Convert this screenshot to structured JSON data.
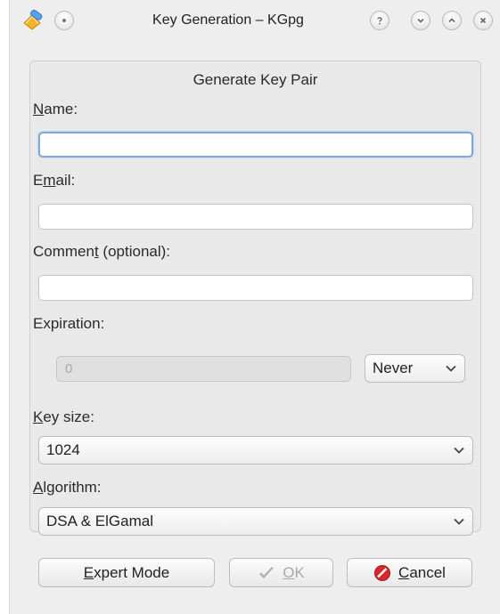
{
  "window": {
    "title": "Key Generation – KGpg"
  },
  "dialog": {
    "group_title": "Generate Key Pair",
    "name": {
      "label_u": "N",
      "label_rest": "ame:",
      "value": ""
    },
    "email": {
      "label_pre": "E",
      "label_u": "m",
      "label_rest": "ail:",
      "value": ""
    },
    "comment": {
      "label_pre": "Commen",
      "label_u": "t",
      "label_rest": " (optional):",
      "value": ""
    },
    "expiration": {
      "label": "Expiration:",
      "value": "0",
      "unit": "Never"
    },
    "key_size": {
      "label_u": "K",
      "label_rest": "ey size:",
      "value": "1024"
    },
    "algorithm": {
      "label_u": "A",
      "label_rest": "lgorithm:",
      "value": "DSA & ElGamal"
    }
  },
  "buttons": {
    "expert": {
      "label_u": "E",
      "label_rest": "xpert Mode"
    },
    "ok": {
      "label_u": "O",
      "label_rest": "K"
    },
    "cancel": {
      "label_u": "C",
      "label_rest": "ancel"
    }
  },
  "colors": {
    "focus_border": "#7fa7d9",
    "cancel_icon": "#d8262b",
    "ok_icon": "#b0b0b0"
  }
}
